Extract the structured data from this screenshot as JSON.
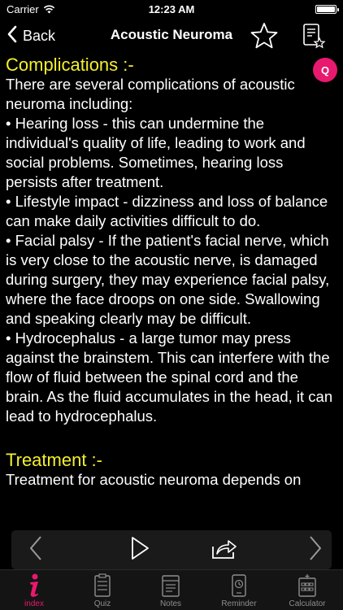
{
  "status_bar": {
    "carrier": "Carrier",
    "time": "12:23 AM",
    "battery_level": 1.0
  },
  "nav": {
    "back_label": "Back",
    "title": "Acoustic Neuroma",
    "icons": [
      "chevron-left-icon",
      "star-icon",
      "notes-icon"
    ]
  },
  "badge": {
    "letter": "Q"
  },
  "content": {
    "complications": {
      "heading": "Complications :-",
      "intro": "There are several complications of acoustic neuroma including:",
      "bullets": [
        "•    Hearing loss - this can undermine the individual's quality of life, leading to work and social problems. Sometimes, hearing loss persists after treatment.",
        "•    Lifestyle impact - dizziness and loss of balance can make daily activities difficult to do.",
        "•    Facial palsy - If the patient's facial nerve, which is very close to the acoustic nerve, is damaged during surgery, they may experience facial palsy, where the face droops on one side. Swallowing and speaking clearly may be difficult.",
        "•    Hydrocephalus - a large tumor may press against the brainstem. This can interfere with the flow of fluid between the spinal cord and the brain. As the fluid accumulates in the head, it can lead to hydrocephalus."
      ]
    },
    "treatment": {
      "heading": "Treatment :-",
      "text": "Treatment for acoustic neuroma depends on"
    }
  },
  "pager": {
    "icons": [
      "chevron-left-icon",
      "play-icon",
      "share-icon",
      "chevron-right-icon"
    ]
  },
  "tabs": [
    {
      "label": "index",
      "icon": "info-icon",
      "active": true
    },
    {
      "label": "Quiz",
      "icon": "quiz-icon",
      "active": false
    },
    {
      "label": "Notes",
      "icon": "notes-icon",
      "active": false
    },
    {
      "label": "Reminder",
      "icon": "reminder-icon",
      "active": false
    },
    {
      "label": "Calculator",
      "icon": "calculator-icon",
      "active": false
    }
  ],
  "colors": {
    "background": "#000000",
    "heading": "#f3f02e",
    "accent": "#e8196f",
    "tab_inactive": "#8e8e8e"
  }
}
